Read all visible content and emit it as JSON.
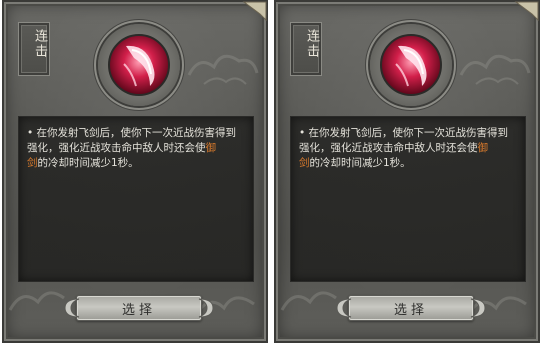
{
  "cards": [
    {
      "title": "连击",
      "icon": "crimson-slash-skill-icon",
      "desc_lines": [
        {
          "pre": "• 在你发射飞剑后，使你下一次近战伤害得到",
          "hl": "",
          "post": ""
        },
        {
          "pre": "强化，强化近战攻击命中敌人时还会使",
          "hl": "御",
          "post": ""
        },
        {
          "pre": "",
          "hl": "剑",
          "post": "的冷却时间减少1秒。"
        }
      ],
      "button_label": "选择"
    },
    {
      "title": "连击",
      "icon": "crimson-slash-skill-icon",
      "desc_lines": [
        {
          "pre": "• 在你发射飞剑后，使你下一次近战伤害得到",
          "hl": "",
          "post": ""
        },
        {
          "pre": "强化，强化近战攻击命中敌人时还会使",
          "hl": "御",
          "post": ""
        },
        {
          "pre": "",
          "hl": "剑",
          "post": "的冷却时间减少1秒。"
        }
      ],
      "button_label": "选择"
    }
  ],
  "colors": {
    "highlight": "#d87a2c",
    "panel": "#5c5c58",
    "text": "#e4e2da"
  }
}
